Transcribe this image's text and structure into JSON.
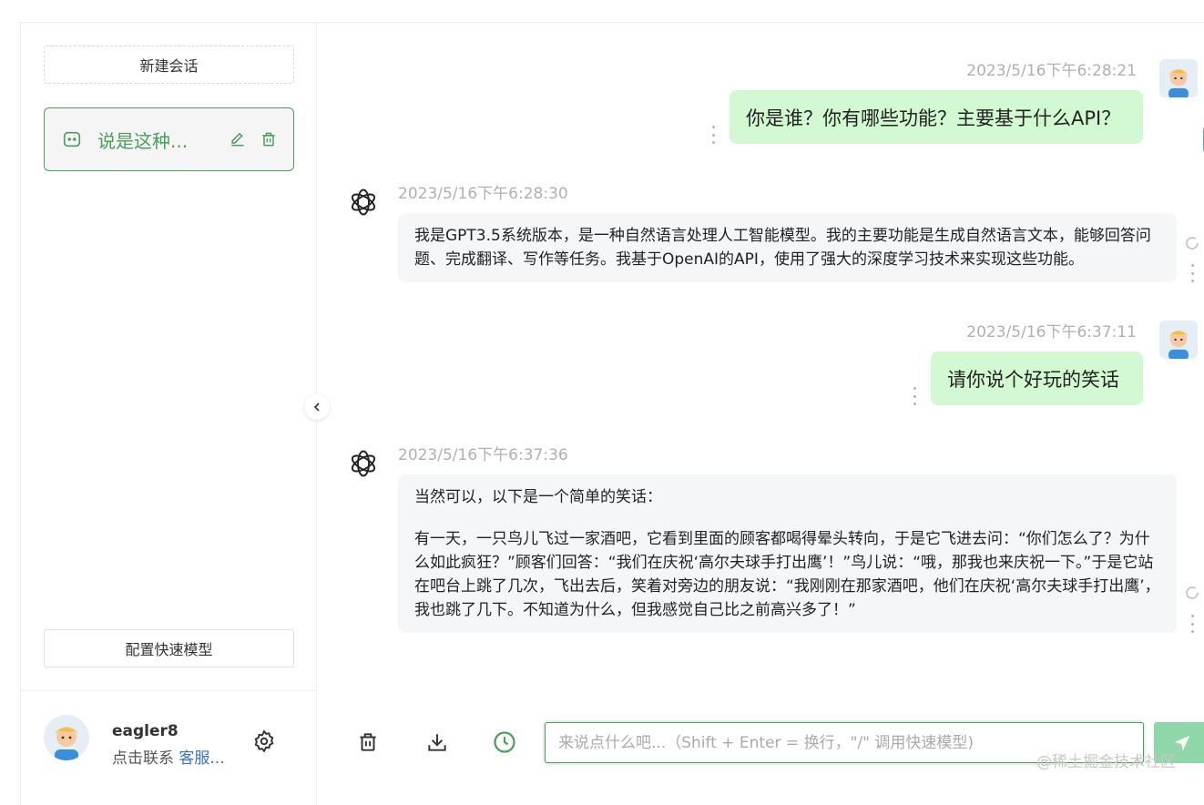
{
  "sidebar": {
    "new_chat_label": "新建会话",
    "conversations": [
      {
        "label": "说是这种...",
        "active": true
      }
    ],
    "config_label": "配置快速模型",
    "user": {
      "name": "eagler8",
      "contact_prefix": "点击联系 ",
      "contact_link": "客服..."
    }
  },
  "messages": [
    {
      "role": "user",
      "time": "2023/5/16下午6:28:21",
      "text": "你是谁？你有哪些功能？主要基于什么API？"
    },
    {
      "role": "assistant",
      "time": "2023/5/16下午6:28:30",
      "paragraphs": [
        "我是GPT3.5系统版本，是一种自然语言处理人工智能模型。我的主要功能是生成自然语言文本，能够回答问题、完成翻译、写作等任务。我基于OpenAI的API，使用了强大的深度学习技术来实现这些功能。"
      ]
    },
    {
      "role": "user",
      "time": "2023/5/16下午6:37:11",
      "text": "请你说个好玩的笑话"
    },
    {
      "role": "assistant",
      "time": "2023/5/16下午6:37:36",
      "paragraphs": [
        "当然可以，以下是一个简单的笑话：",
        "有一天，一只鸟儿飞过一家酒吧，它看到里面的顾客都喝得晕头转向，于是它飞进去问：“你们怎么了？为什么如此疯狂？”顾客们回答：“我们在庆祝‘高尔夫球手打出鹰’！”鸟儿说：“哦，那我也来庆祝一下。”于是它站在吧台上跳了几次，飞出去后，笑着对旁边的朋友说：“我刚刚在那家酒吧，他们在庆祝‘高尔夫球手打出鹰’，我也跳了几下。不知道为什么，但我感觉自己比之前高兴多了！”"
      ]
    }
  ],
  "composer": {
    "placeholder": "来说点什么吧...（Shift + Enter = 换行，\"/\" 调用快速模型)"
  },
  "watermark": "@稀土掘金技术社区",
  "colors": {
    "accent": "#4b9e5f",
    "user_bubble": "#d2f9d1",
    "bot_bubble": "#f4f6f8",
    "send_button": "#8fd6a8"
  }
}
